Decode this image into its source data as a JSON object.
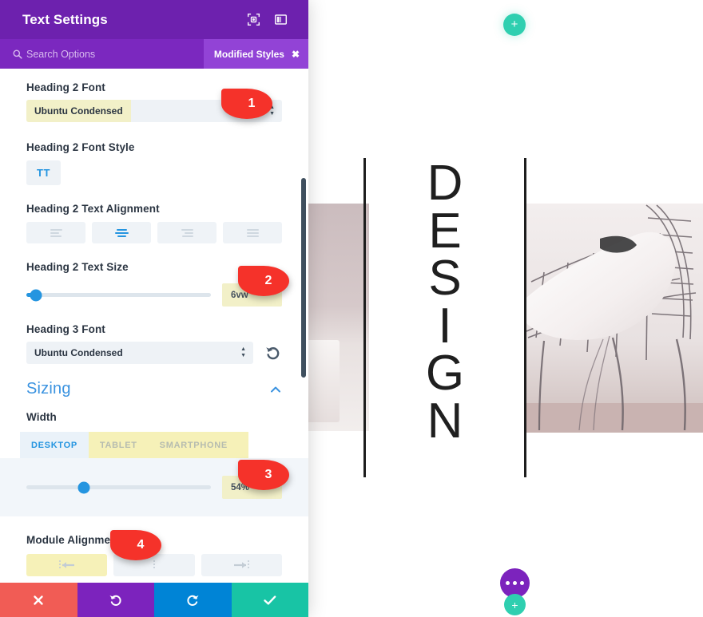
{
  "panel": {
    "title": "Text Settings",
    "header_icons": [
      {
        "name": "focus-target-icon"
      },
      {
        "name": "layout-panel-icon"
      }
    ],
    "search": {
      "placeholder": "Search Options",
      "icon": "search-icon"
    },
    "modified_badge": {
      "label": "Modified Styles",
      "close": "✖"
    },
    "fields": [
      {
        "id": "heading2-font",
        "label": "Heading 2 Font",
        "type": "select",
        "value": "Ubuntu Condensed",
        "highlighted": true
      },
      {
        "id": "heading2-font-style",
        "label": "Heading 2 Font Style",
        "type": "toggle-button",
        "value": "TT"
      },
      {
        "id": "heading2-text-alignment",
        "label": "Heading 2 Text Alignment",
        "type": "button-group",
        "options": [
          {
            "icon": "align-left-icon",
            "active": false
          },
          {
            "icon": "align-center-icon",
            "active": true
          },
          {
            "icon": "align-right-icon",
            "active": false
          },
          {
            "icon": "align-justify-icon",
            "active": false
          }
        ]
      },
      {
        "id": "heading2-text-size",
        "label": "Heading 2 Text Size",
        "type": "slider",
        "value": "6vw",
        "percent": 5
      },
      {
        "id": "heading3-font",
        "label": "Heading 3 Font",
        "type": "select",
        "value": "Ubuntu Condensed",
        "highlighted": false,
        "reset_icon": "reset-arrow-icon"
      }
    ],
    "sizing": {
      "title": "Sizing",
      "collapse_icon": "chevron-up-icon",
      "width_label": "Width",
      "device_tabs": [
        {
          "label": "DESKTOP",
          "active": true
        },
        {
          "label": "TABLET",
          "active": false
        },
        {
          "label": "SMARTPHONE",
          "active": false
        }
      ],
      "width_slider": {
        "value": "54%",
        "percent": 54
      }
    },
    "module_alignment": {
      "label": "Module Alignment",
      "options": [
        {
          "icon": "align-module-left-icon",
          "active": true
        },
        {
          "icon": "align-module-center-icon",
          "active": false
        },
        {
          "icon": "align-module-right-icon",
          "active": false
        }
      ]
    },
    "footer_buttons": [
      {
        "name": "discard-button",
        "icon": "close-x-icon",
        "color": "#f15c55"
      },
      {
        "name": "undo-button",
        "icon": "undo-arrow-icon",
        "color": "#7c23bd"
      },
      {
        "name": "redo-button",
        "icon": "redo-arrow-icon",
        "color": "#0084d6"
      },
      {
        "name": "save-button",
        "icon": "checkmark-icon",
        "color": "#18c4a5"
      }
    ]
  },
  "preview": {
    "heading_text": "DESIGN",
    "letters": [
      "D",
      "E",
      "S",
      "I",
      "G",
      "N"
    ],
    "add_top_label": "+",
    "add_bottom_label": "+",
    "settings_dots": "⋯"
  },
  "callouts": [
    {
      "id": 1,
      "number": "1"
    },
    {
      "id": 2,
      "number": "2"
    },
    {
      "id": 3,
      "number": "3"
    },
    {
      "id": 4,
      "number": "4"
    }
  ],
  "colors": {
    "panel_header": "#6d21ae",
    "panel_search": "#7b28bf",
    "badge": "#9243d6",
    "accent_blue": "#2595e0",
    "highlight_yellow": "#f2f0c8",
    "callout_red": "#f5322a",
    "teal": "#2fcfb0",
    "purple_dot": "#7c23bd"
  }
}
